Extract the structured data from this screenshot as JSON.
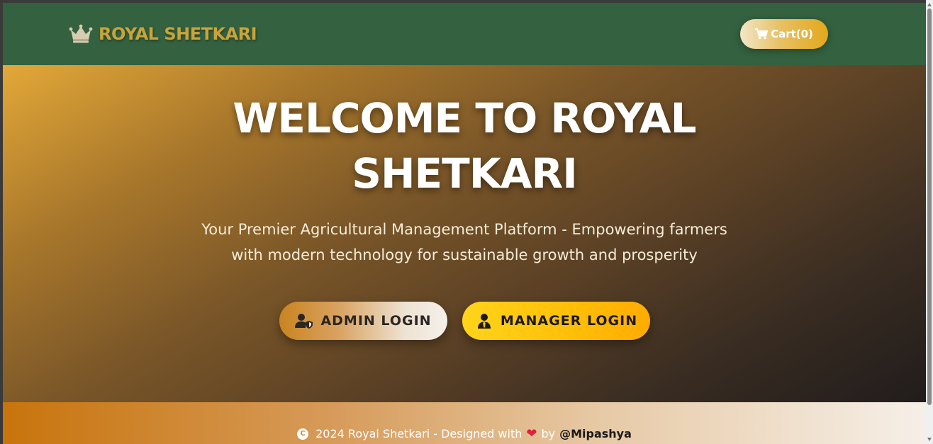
{
  "header": {
    "brand": "ROYAL SHETKARI",
    "brand_icon": "crown-icon",
    "cart_label": "Cart(0)",
    "cart_icon": "shopping-cart-icon"
  },
  "hero": {
    "title_line1": "WELCOME TO ROYAL",
    "title_line2": "SHETKARI",
    "subtitle_line1": "Your Premier Agricultural Management Platform - Empowering farmers",
    "subtitle_line2": "with modern technology for sustainable growth and prosperity",
    "buttons": {
      "admin_label": "ADMIN LOGIN",
      "admin_icon": "user-shield-icon",
      "manager_label": "MANAGER LOGIN",
      "manager_icon": "user-tie-icon"
    }
  },
  "footer": {
    "copyright_symbol": "C",
    "text_before_heart": "2024 Royal Shetkari - Designed with",
    "heart": "❤",
    "by": "by",
    "author": "@Mipashya"
  },
  "colors": {
    "navbar": "#34613f",
    "brand_gold": "#c9a43a",
    "manager_button": "#ffc20a",
    "heart": "#e0213c"
  }
}
